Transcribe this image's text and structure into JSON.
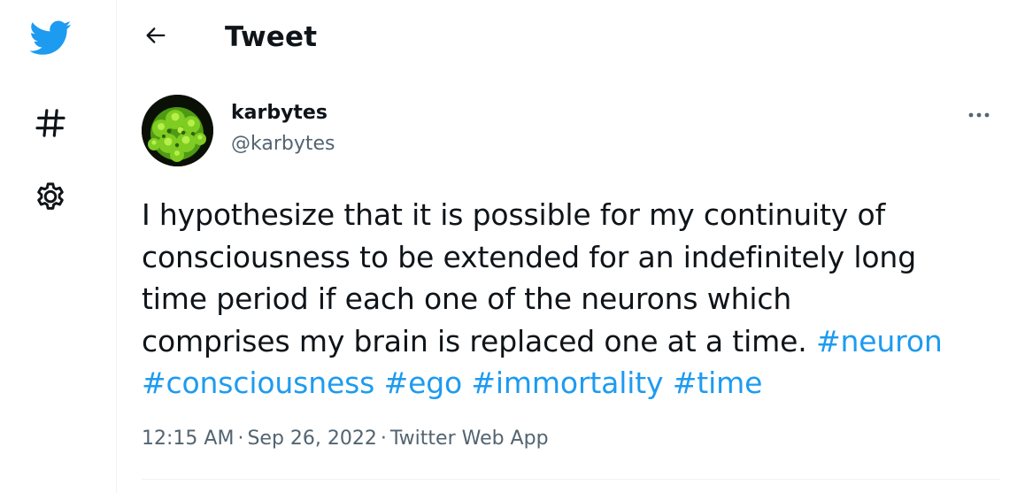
{
  "colors": {
    "brand": "#1d9bf0",
    "text": "#0f1419",
    "muted": "#536471"
  },
  "rail": {
    "items": [
      {
        "icon": "twitter-bird-icon"
      },
      {
        "icon": "hashtag-icon"
      },
      {
        "icon": "gear-icon"
      }
    ]
  },
  "header": {
    "title": "Tweet",
    "back_icon": "arrow-left-icon"
  },
  "tweet": {
    "author": {
      "display_name": "karbytes",
      "handle": "@karbytes"
    },
    "more_icon": "more-dots-icon",
    "text_lines": [
      "I hypothesize that it is possible for my continuity of",
      "consciousness to be extended for an indefinitely long",
      "time period if each one of the neurons which",
      "comprises my brain is replaced one at a time."
    ],
    "hashtags": [
      "#neuron",
      "#consciousness",
      "#ego",
      "#immortality",
      "#time"
    ],
    "time": "12:15 AM",
    "date": "Sep 26, 2022",
    "source": "Twitter Web App",
    "separator": "·"
  }
}
